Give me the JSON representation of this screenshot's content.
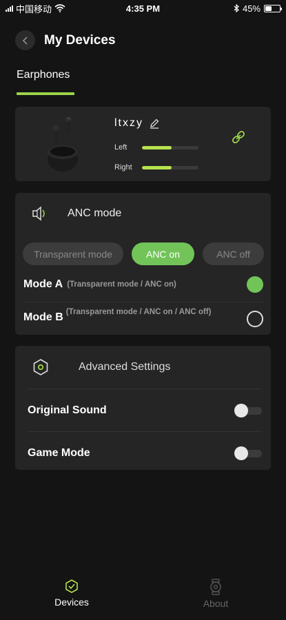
{
  "status_bar": {
    "carrier": "中国移动",
    "time": "4:35 PM",
    "battery_percent": "45%",
    "battery_level": 0.45,
    "icons": [
      "signal-icon",
      "wifi-icon",
      "bluetooth-icon",
      "battery-icon"
    ]
  },
  "header": {
    "title": "My Devices",
    "back_icon": "chevron-left-icon"
  },
  "tabs": [
    {
      "label": "Earphones",
      "active": true
    }
  ],
  "device": {
    "name": "ltxzy",
    "edit_icon": "pencil-icon",
    "link_icon": "link-icon",
    "battery": [
      {
        "label": "Left",
        "level": 0.52
      },
      {
        "label": "Right",
        "level": 0.52
      }
    ]
  },
  "anc": {
    "title": "ANC mode",
    "icon": "speaker-icon",
    "options": [
      {
        "label": "Transparent mode",
        "active": false
      },
      {
        "label": "ANC on",
        "active": true
      },
      {
        "label": "ANC off",
        "active": false
      }
    ],
    "modes": [
      {
        "label": "Mode A",
        "description": "(Transparent mode / ANC on)",
        "selected": true
      },
      {
        "label": "Mode B",
        "description": "(Transparent mode / ANC on / ANC off)",
        "selected": false
      }
    ]
  },
  "advanced": {
    "title": "Advanced Settings",
    "icon": "hexagon-settings-icon",
    "settings": [
      {
        "label": "Original Sound",
        "enabled": false
      },
      {
        "label": "Game Mode",
        "enabled": false
      }
    ]
  },
  "bottom_nav": [
    {
      "label": "Devices",
      "icon": "earphones-icon",
      "active": true
    },
    {
      "label": "About",
      "icon": "watch-icon",
      "active": false
    }
  ],
  "colors": {
    "accent": "#72c459",
    "battery_bar": "#b6e34f",
    "tab_underline": "#9cd34a",
    "background": "#141414",
    "card": "#252525"
  }
}
